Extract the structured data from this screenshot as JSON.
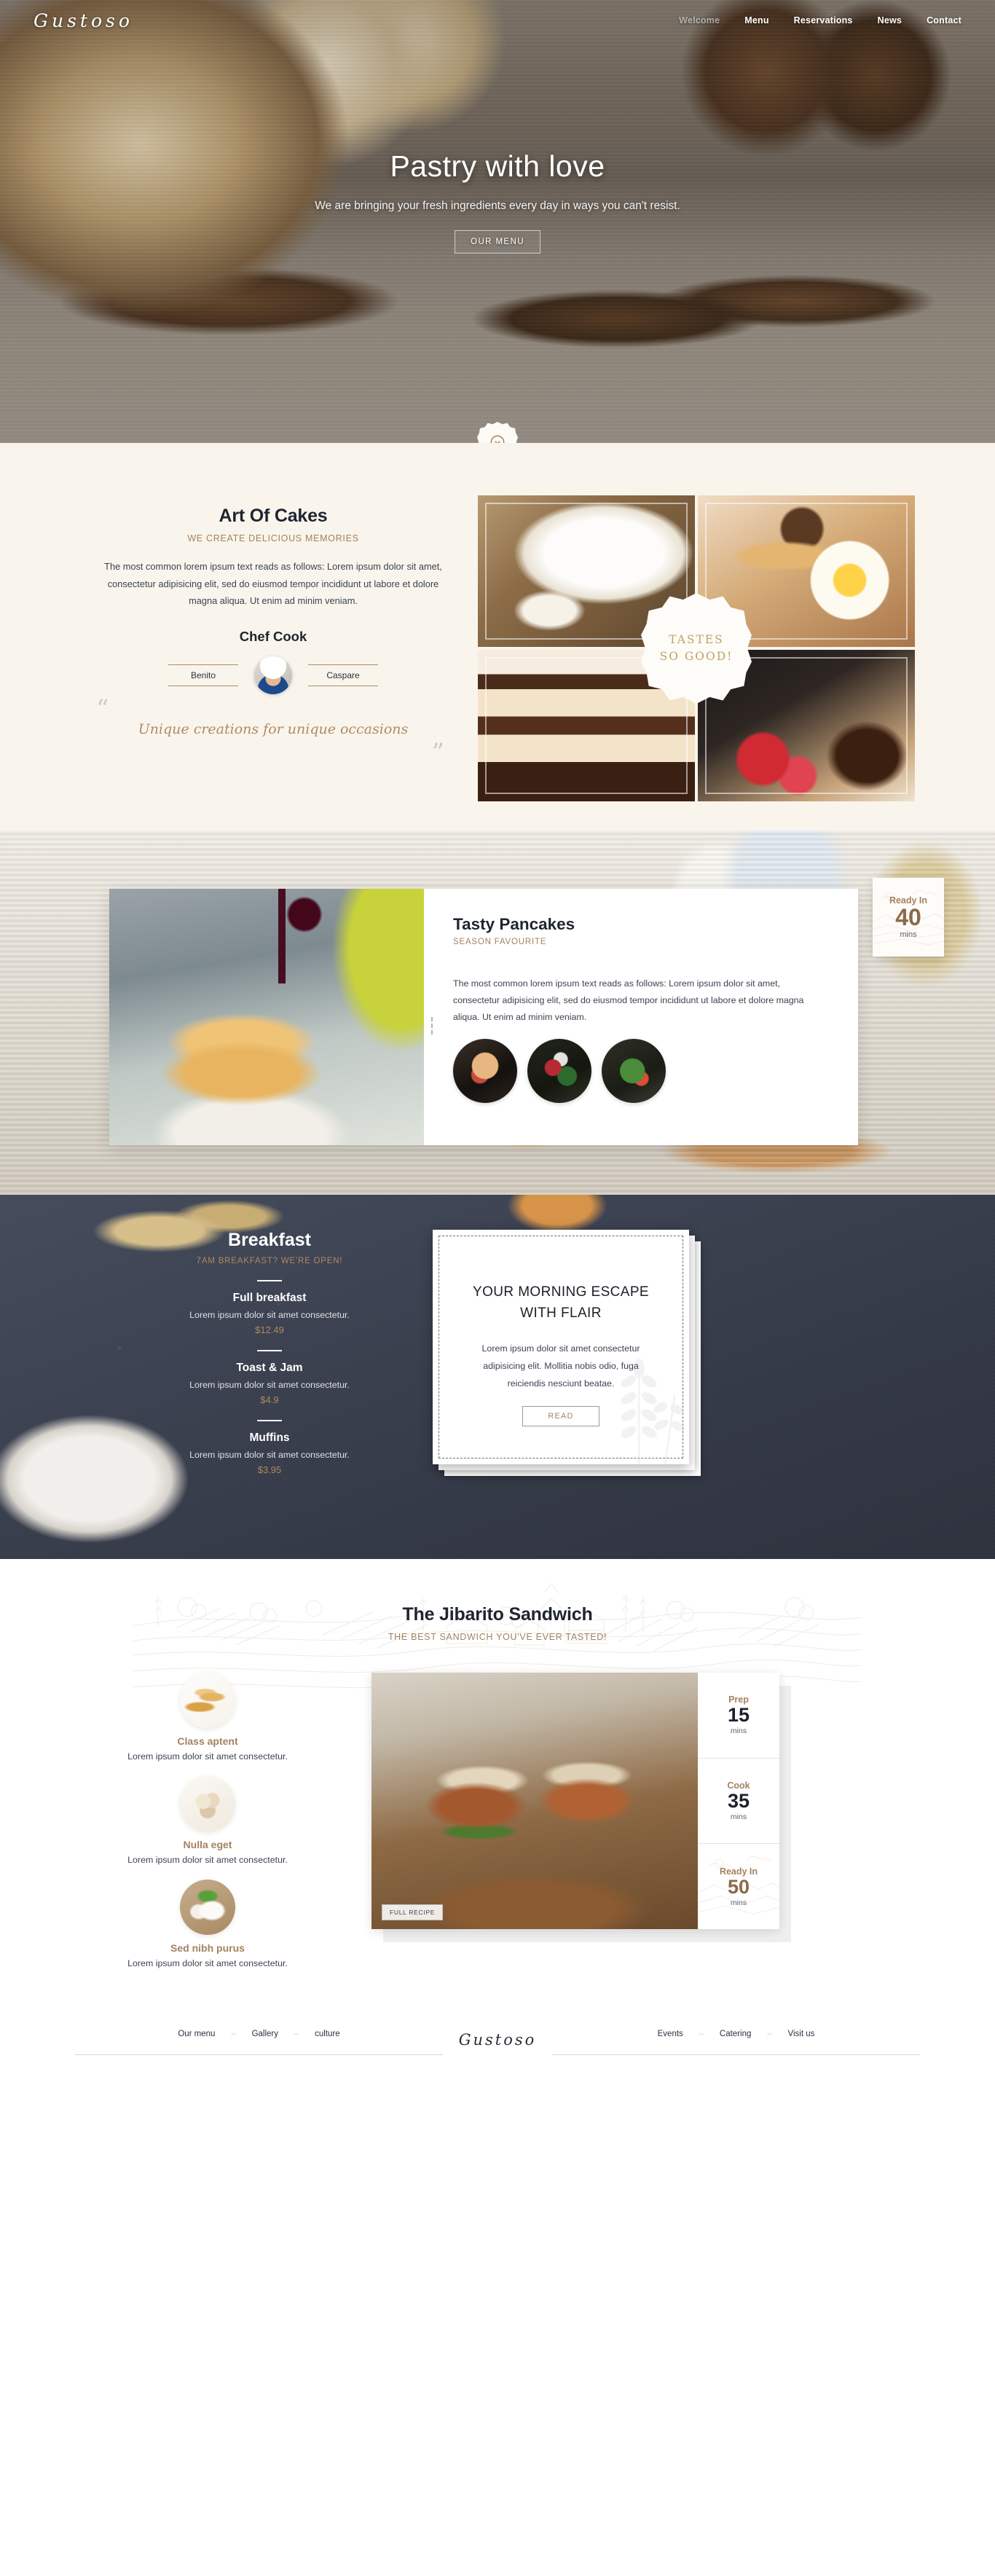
{
  "site": {
    "logo": "Gustoso",
    "footer_logo": "Gustoso"
  },
  "nav": {
    "items": [
      {
        "label": "Welcome",
        "active": true
      },
      {
        "label": "Menu",
        "active": false
      },
      {
        "label": "Reservations",
        "active": false
      },
      {
        "label": "News",
        "active": false
      },
      {
        "label": "Contact",
        "active": false
      }
    ]
  },
  "hero": {
    "title": "Pastry with love",
    "subtitle": "We are bringing your fresh ingredients every day in ways you can't resist.",
    "cta": "OUR MENU",
    "scroll_icon": "scroll-down-icon"
  },
  "cakes": {
    "title": "Art Of Cakes",
    "kicker": "WE CREATE DELICIOUS MEMORIES",
    "paragraph": "The most common lorem ipsum text reads as follows: Lorem ipsum dolor sit amet, consectetur adipisicing elit, sed do eiusmod tempor incididunt ut labore et dolore magna aliqua. Ut enim ad minim veniam.",
    "chef_heading": "Chef Cook",
    "chef_left": "Benito",
    "chef_right": "Caspare",
    "quote_open": "“",
    "quote_close": "”",
    "quote": "Unique creations for unique occasions",
    "badge": "TASTES SO GOOD!",
    "photos": [
      {
        "name": "flour-bowl-photo"
      },
      {
        "name": "bread-and-egg-photo"
      },
      {
        "name": "layer-cake-photo"
      },
      {
        "name": "brownie-strawberry-photo"
      }
    ]
  },
  "pancakes": {
    "title": "Tasty Pancakes",
    "kicker": "SEASON FAVOURITE",
    "paragraph": "The most common lorem ipsum text reads as follows: Lorem ipsum dolor sit amet, consectetur adipisicing elit, sed do eiusmod tempor incididunt ut labore et dolore magna aliqua. Ut enim ad minim veniam.",
    "thumbnails": [
      {
        "name": "dessert-thumb-1"
      },
      {
        "name": "salad-thumb-2"
      },
      {
        "name": "greens-thumb-3"
      }
    ],
    "ready": {
      "label": "Ready In",
      "value": "40",
      "unit": "mins"
    }
  },
  "breakfast": {
    "title": "Breakfast",
    "kicker": "7AM BREAKFAST? WE'RE OPEN!",
    "items": [
      {
        "name": "Full breakfast",
        "desc": "Lorem ipsum dolor sit amet consectetur.",
        "price": "$12.49"
      },
      {
        "name": "Toast & Jam",
        "desc": "Lorem ipsum dolor sit amet consectetur.",
        "price": "$4.9"
      },
      {
        "name": "Muffins",
        "desc": "Lorem ipsum dolor sit amet consectetur.",
        "price": "$3.95"
      }
    ],
    "card": {
      "heading": "YOUR MORNING ESCAPE WITH FLAIR",
      "paragraph": "Lorem ipsum dolor sit amet consectetur adipisicing elit. Mollitia nobis odio, fuga reiciendis nesciunt beatae.",
      "cta": "READ"
    }
  },
  "jibarito": {
    "title": "The Jibarito Sandwich",
    "kicker": "THE BEST SANDWICH YOU'VE EVER TASTED!",
    "features": [
      {
        "name": "Class aptent",
        "desc": "Lorem ipsum dolor sit amet consectetur.",
        "icon": "wheat-photo-icon"
      },
      {
        "name": "Nulla eget",
        "desc": "Lorem ipsum dolor sit amet consectetur.",
        "icon": "eggs-photo-icon"
      },
      {
        "name": "Sed nibh purus",
        "desc": "Lorem ipsum dolor sit amet consectetur.",
        "icon": "cheese-photo-icon"
      }
    ],
    "full_recipe": "FULL RECIPE",
    "stats": [
      {
        "label": "Prep",
        "value": "15",
        "unit": "mins"
      },
      {
        "label": "Cook",
        "value": "35",
        "unit": "mins"
      },
      {
        "label": "Ready In",
        "value": "50",
        "unit": "mins"
      }
    ]
  },
  "footer": {
    "left_links": [
      "Our menu",
      "Gallery",
      "culture"
    ],
    "right_links": [
      "Events",
      "Catering",
      "Visit us"
    ],
    "separator": "–"
  },
  "colors": {
    "accent": "#a4825f",
    "dark": "#1f2430",
    "cream": "#f9f5ec",
    "slate": "#3a4050"
  }
}
